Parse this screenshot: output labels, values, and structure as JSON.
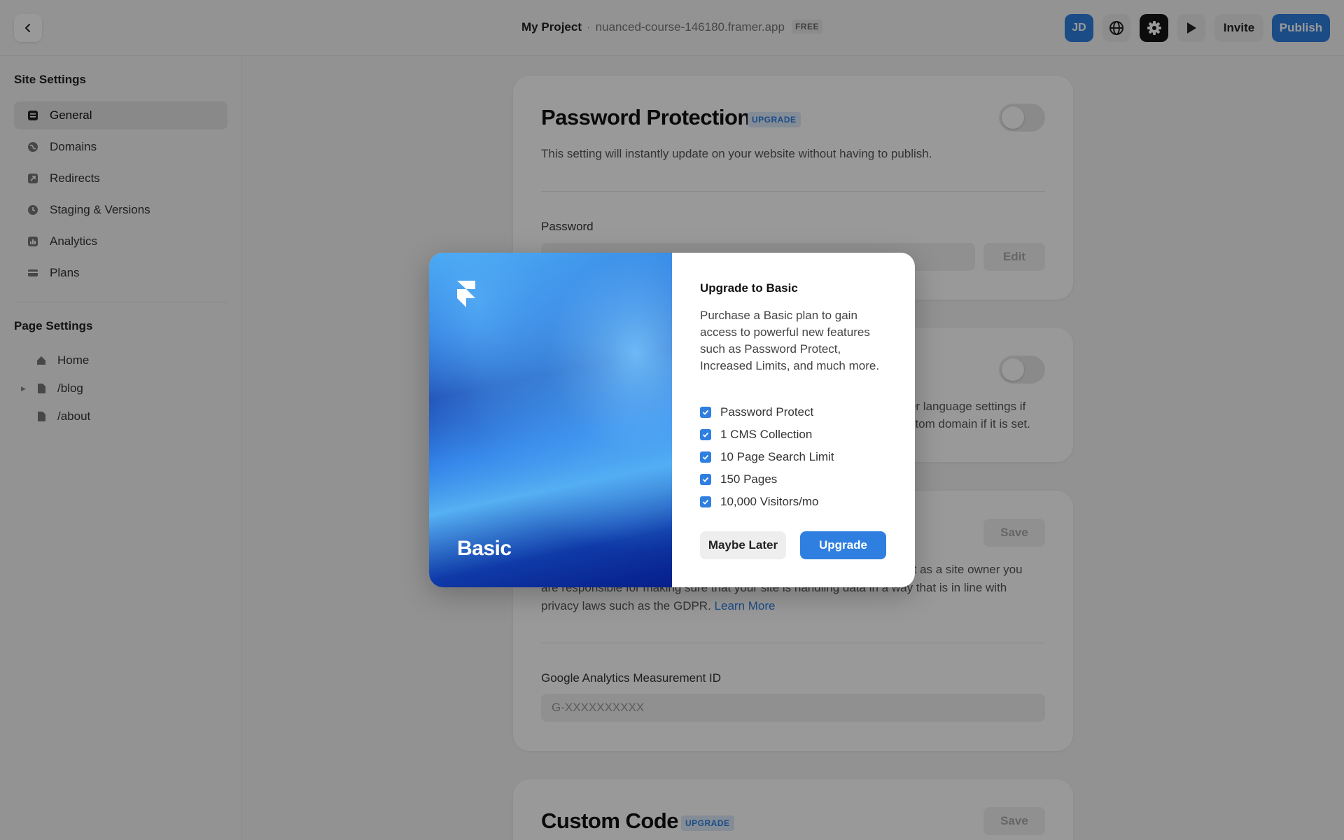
{
  "topbar": {
    "project_name": "My Project",
    "separator": "·",
    "project_url": "nuanced-course-146180.framer.app",
    "plan_badge": "FREE",
    "avatar_initials": "JD",
    "invite_label": "Invite",
    "publish_label": "Publish",
    "icons": [
      "chevron-left-icon",
      "globe-icon",
      "gear-icon",
      "play-icon"
    ]
  },
  "sidebar": {
    "site_heading": "Site Settings",
    "site_items": [
      {
        "label": "General",
        "icon": "general-icon",
        "active": true
      },
      {
        "label": "Domains",
        "icon": "domains-icon",
        "active": false
      },
      {
        "label": "Redirects",
        "icon": "redirects-icon",
        "active": false
      },
      {
        "label": "Staging & Versions",
        "icon": "clock-icon",
        "active": false
      },
      {
        "label": "Analytics",
        "icon": "analytics-icon",
        "active": false
      },
      {
        "label": "Plans",
        "icon": "card-icon",
        "active": false
      }
    ],
    "page_heading": "Page Settings",
    "pages": [
      {
        "label": "Home",
        "icon": "home-icon",
        "expandable": false
      },
      {
        "label": "/blog",
        "icon": "page-icon",
        "expandable": true
      },
      {
        "label": "/about",
        "icon": "page-icon",
        "expandable": false
      }
    ]
  },
  "main": {
    "password_card": {
      "title": "Password Protection",
      "badge": "UPGRADE",
      "description": "This setting will instantly update on your website without having to publish.",
      "field_label": "Password",
      "edit_label": "Edit"
    },
    "language_card": {
      "desc_line1": "user language settings if",
      "desc_line2": "custom domain if it is set."
    },
    "analytics_card": {
      "save_label": "Save",
      "desc_line1_tail": "that as a site owner you",
      "desc_line2": "are responsible for making sure that your site is handling data in a way that is in line with",
      "desc_line3": "privacy laws such as the GDPR.",
      "learn_more": "Learn More",
      "field_label": "Google Analytics Measurement ID",
      "field_placeholder": "G-XXXXXXXXXX"
    },
    "code_card": {
      "title": "Custom Code",
      "badge": "UPGRADE",
      "save_label": "Save"
    }
  },
  "modal": {
    "art_title": "Basic",
    "title": "Upgrade to Basic",
    "description": "Purchase a Basic plan to gain access to powerful new features such as Password Protect, Increased Limits, and much more.",
    "features": [
      {
        "label": "Password Protect",
        "checked": true
      },
      {
        "label": "1 CMS Collection",
        "checked": true
      },
      {
        "label": "10 Page Search Limit",
        "checked": true
      },
      {
        "label": "150 Pages",
        "checked": true
      },
      {
        "label": "10,000 Visitors/mo",
        "checked": true
      }
    ],
    "secondary_label": "Maybe Later",
    "primary_label": "Upgrade"
  },
  "colors": {
    "accent": "#2f7fe0",
    "overlay": "rgba(0,0,0,0.4)",
    "badge_bg": "#dce9fb"
  }
}
